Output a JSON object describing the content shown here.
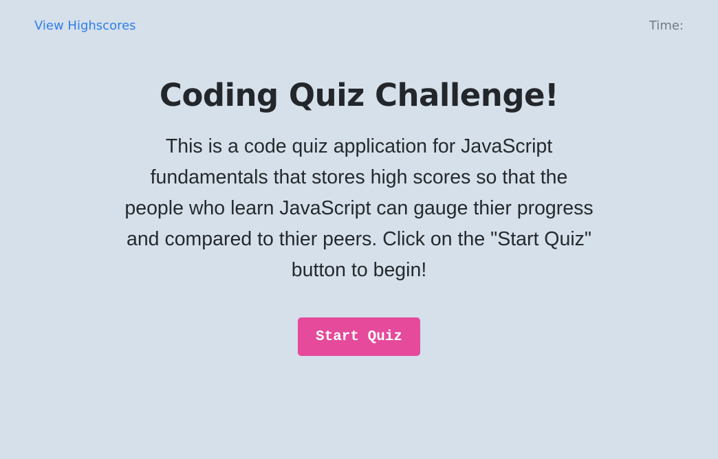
{
  "header": {
    "highscores_label": "View Highscores",
    "timer_label": "Time:",
    "timer_value": ""
  },
  "main": {
    "title": "Coding Quiz Challenge!",
    "intro": "This is a code quiz application for JavaScript fundamentals that stores high scores so that the people who learn JavaScript can gauge thier progress and compared to thier peers. Click on the \"Start Quiz\" button to begin!",
    "start_button_label": "Start Quiz"
  },
  "colors": {
    "background": "#d5e0ea",
    "link": "#2f7ee8",
    "button": "#e54a9b",
    "text": "#23272b",
    "muted": "#737b83"
  }
}
